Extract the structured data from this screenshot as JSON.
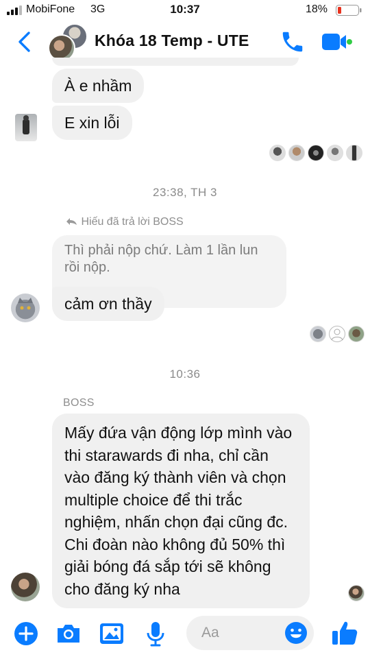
{
  "status_bar": {
    "carrier": "MobiFone",
    "network": "3G",
    "time": "10:37",
    "battery": "18%"
  },
  "header": {
    "title": "Khóa 18 Temp - UTE",
    "accent_color": "#0a7cff"
  },
  "messages": [
    {
      "text": "À e nhầm"
    },
    {
      "text": "E xin lỗi"
    },
    {
      "text": "Thì phải nộp chứ. Làm 1 lần lun rồi nộp."
    },
    {
      "text": "cảm ơn thầy"
    },
    {
      "text": "Mấy đứa vận động lớp mình vào thi starawards đi nha, chỉ cần vào đăng ký thành viên và chọn multiple choice để thi trắc nghiệm, nhấn chọn đại cũng đc. Chi đoàn nào không đủ 50% thì giải bóng đá sắp tới sẽ không cho đăng ký nha"
    }
  ],
  "timestamps": {
    "first": "23:38, TH 3",
    "second": "10:36"
  },
  "reply_note": "Hiếu đã trả lời BOSS",
  "sender_name": "BOSS",
  "composer": {
    "placeholder": "Aa"
  },
  "icons": [
    "back-icon",
    "phone-icon",
    "video-icon",
    "plus-icon",
    "camera-icon",
    "gallery-icon",
    "microphone-icon",
    "emoji-icon",
    "thumbs-up-icon",
    "reply-icon"
  ]
}
